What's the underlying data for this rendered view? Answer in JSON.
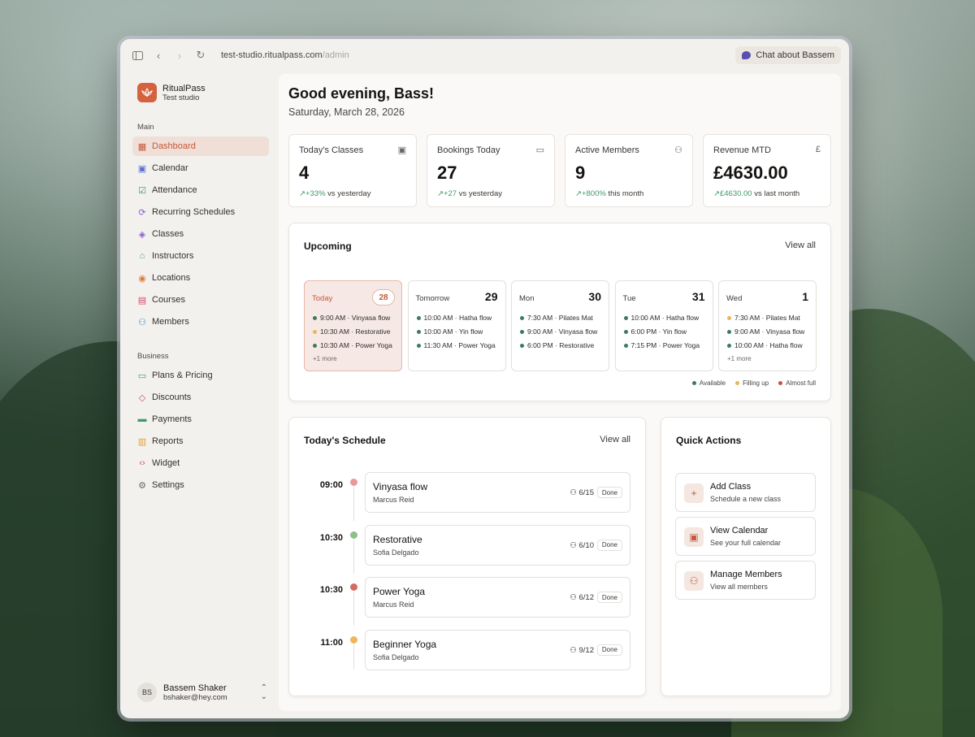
{
  "browser": {
    "url_host": "test-studio.ritualpass.com",
    "url_path": "/admin",
    "chat_button": "Chat about Bassem"
  },
  "sidebar": {
    "brand_name": "RitualPass",
    "brand_sub": "Test studio",
    "main_label": "Main",
    "main_items": [
      {
        "label": "Dashboard",
        "icon": "dashboard-icon",
        "active": true
      },
      {
        "label": "Calendar",
        "icon": "calendar-icon"
      },
      {
        "label": "Attendance",
        "icon": "clipboard-check-icon"
      },
      {
        "label": "Recurring Schedules",
        "icon": "refresh-icon"
      },
      {
        "label": "Classes",
        "icon": "layers-icon"
      },
      {
        "label": "Instructors",
        "icon": "graduation-cap-icon"
      },
      {
        "label": "Locations",
        "icon": "map-pin-icon"
      },
      {
        "label": "Courses",
        "icon": "book-icon"
      },
      {
        "label": "Members",
        "icon": "users-icon"
      }
    ],
    "business_label": "Business",
    "business_items": [
      {
        "label": "Plans & Pricing",
        "icon": "credit-card-icon"
      },
      {
        "label": "Discounts",
        "icon": "tag-icon"
      },
      {
        "label": "Payments",
        "icon": "banknote-icon"
      },
      {
        "label": "Reports",
        "icon": "bar-chart-icon"
      },
      {
        "label": "Widget",
        "icon": "code-icon"
      },
      {
        "label": "Settings",
        "icon": "gear-icon"
      }
    ],
    "user": {
      "initials": "BS",
      "name": "Bassem Shaker",
      "email": "bshaker@hey.com"
    }
  },
  "header": {
    "greeting": "Good evening, Bass!",
    "date": "Saturday, March 28, 2026"
  },
  "stats": [
    {
      "label": "Today's Classes",
      "value": "4",
      "change": "+33%",
      "suffix": "vs yesterday",
      "icon": "calendar-icon"
    },
    {
      "label": "Bookings Today",
      "value": "27",
      "change": "+27",
      "suffix": "vs yesterday",
      "icon": "ticket-icon"
    },
    {
      "label": "Active Members",
      "value": "9",
      "change": "+800%",
      "suffix": "this month",
      "icon": "users-icon"
    },
    {
      "label": "Revenue MTD",
      "value": "£4630.00",
      "change": "£4630.00",
      "suffix": "vs last month",
      "icon": "pound-icon"
    }
  ],
  "upcoming": {
    "title": "Upcoming",
    "view_all": "View all",
    "days": [
      {
        "name": "Today",
        "num": "28",
        "events": [
          {
            "text": "9:00 AM · Vinyasa flow",
            "status": "available"
          },
          {
            "text": "10:30 AM · Restorative",
            "status": "filling"
          },
          {
            "text": "10:30 AM · Power Yoga",
            "status": "available"
          }
        ],
        "more": "+1 more"
      },
      {
        "name": "Tomorrow",
        "num": "29",
        "events": [
          {
            "text": "10:00 AM · Hatha flow",
            "status": "available"
          },
          {
            "text": "10:00 AM · Yin flow",
            "status": "available"
          },
          {
            "text": "11:30 AM · Power Yoga",
            "status": "available"
          }
        ]
      },
      {
        "name": "Mon",
        "num": "30",
        "events": [
          {
            "text": "7:30 AM · Pilates Mat",
            "status": "available"
          },
          {
            "text": "9:00 AM · Vinyasa flow",
            "status": "available"
          },
          {
            "text": "6:00 PM · Restorative",
            "status": "available"
          }
        ]
      },
      {
        "name": "Tue",
        "num": "31",
        "events": [
          {
            "text": "10:00 AM · Hatha flow",
            "status": "available"
          },
          {
            "text": "6:00 PM · Yin flow",
            "status": "available"
          },
          {
            "text": "7:15 PM · Power Yoga",
            "status": "available"
          }
        ]
      },
      {
        "name": "Wed",
        "num": "1",
        "events": [
          {
            "text": "7:30 AM · Pilates Mat",
            "status": "filling"
          },
          {
            "text": "9:00 AM · Vinyasa flow",
            "status": "available"
          },
          {
            "text": "10:00 AM · Hatha flow",
            "status": "available"
          }
        ],
        "more": "+1 more"
      }
    ],
    "legend": {
      "available": "Available",
      "filling": "Filling up",
      "full": "Almost full"
    }
  },
  "colors": {
    "available": "#3d7a5e",
    "filling": "#e9b65b",
    "full": "#c9504a",
    "accent": "#c4583a"
  },
  "schedule": {
    "title": "Today's Schedule",
    "view_all": "View all",
    "items": [
      {
        "time": "09:00",
        "name": "Vinyasa flow",
        "instructor": "Marcus Reid",
        "count": "6/15",
        "status": "Done",
        "dot": "#ea9a96"
      },
      {
        "time": "10:30",
        "name": "Restorative",
        "instructor": "Sofia Delgado",
        "count": "6/10",
        "status": "Done",
        "dot": "#8ec18a"
      },
      {
        "time": "10:30",
        "name": "Power Yoga",
        "instructor": "Marcus Reid",
        "count": "6/12",
        "status": "Done",
        "dot": "#d56a62"
      },
      {
        "time": "11:00",
        "name": "Beginner Yoga",
        "instructor": "Sofia Delgado",
        "count": "9/12",
        "status": "Done",
        "dot": "#f0b45a"
      }
    ]
  },
  "quick_actions": {
    "title": "Quick Actions",
    "items": [
      {
        "title": "Add Class",
        "sub": "Schedule a new class",
        "icon": "plus-icon"
      },
      {
        "title": "View Calendar",
        "sub": "See your full calendar",
        "icon": "calendar-icon"
      },
      {
        "title": "Manage Members",
        "sub": "View all members",
        "icon": "users-icon"
      }
    ]
  }
}
